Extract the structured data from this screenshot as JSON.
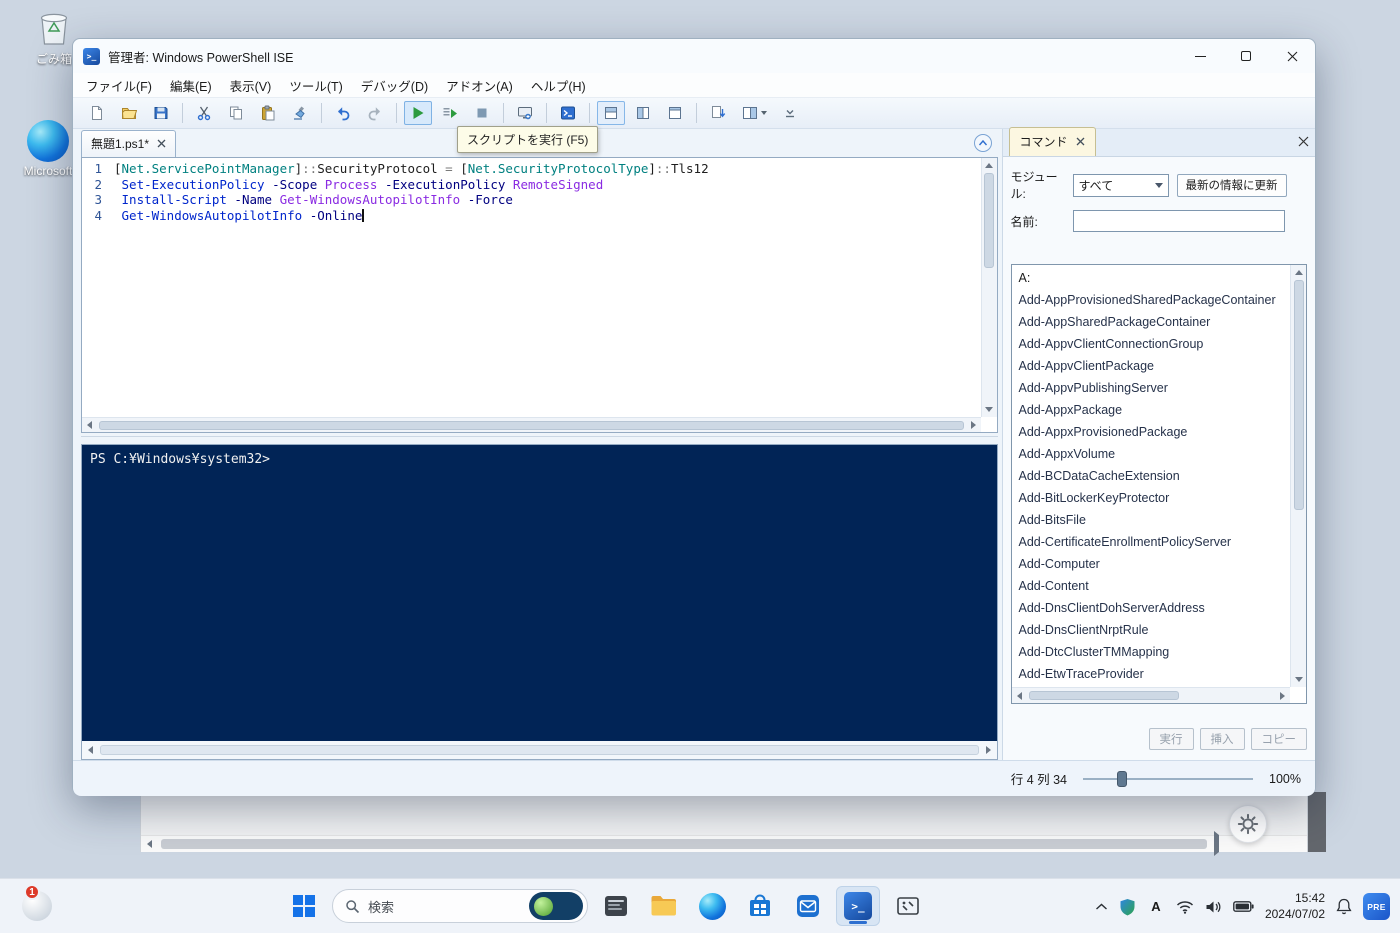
{
  "desktop": {
    "recycle_bin_label": "ごみ箱",
    "edge_label": "Microsoft"
  },
  "ise": {
    "title": "管理者: Windows PowerShell ISE",
    "menus": [
      "ファイル(F)",
      "編集(E)",
      "表示(V)",
      "ツール(T)",
      "デバッグ(D)",
      "アドオン(A)",
      "ヘルプ(H)"
    ],
    "toolbar": [
      "new-script-icon",
      "open-script-icon",
      "save-icon",
      "separator",
      "cut-icon",
      "copy-icon",
      "paste-icon",
      "clear-console-icon",
      "separator",
      "undo-icon",
      "redo-icon",
      "separator",
      "run-script-icon",
      "run-selection-icon",
      "stop-icon",
      "separator",
      "new-remote-tab-icon",
      "separator",
      "console-icon",
      "separator",
      "layout-top-bottom-icon",
      "layout-side-by-side-icon",
      "layout-maximized-icon",
      "separator",
      "script-pane-toggle-icon",
      "script-pane-right-icon",
      "toolbar-overflow-icon"
    ],
    "tooltip": "スクリプトを実行 (F5)",
    "editor": {
      "tab_label": "無題1.ps1*",
      "lines": [
        {
          "n": "1",
          "cursor": false,
          "seg": [
            [
              "[",
              "plain"
            ],
            [
              "Net.ServicePointManager",
              "type"
            ],
            [
              "]",
              "plain"
            ],
            [
              "::",
              "op"
            ],
            [
              "SecurityProtocol",
              "plain"
            ],
            [
              " = ",
              "op"
            ],
            [
              "[",
              "plain"
            ],
            [
              "Net.SecurityProtocolType",
              "type"
            ],
            [
              "]",
              "plain"
            ],
            [
              "::",
              "op"
            ],
            [
              "Tls12",
              "plain"
            ]
          ]
        },
        {
          "n": "2",
          "cursor": false,
          "seg": [
            [
              " ",
              "plain"
            ],
            [
              "Set-ExecutionPolicy",
              "cmd"
            ],
            [
              " ",
              "plain"
            ],
            [
              "-Scope",
              "param"
            ],
            [
              " ",
              "plain"
            ],
            [
              "Process",
              "arg"
            ],
            [
              " ",
              "plain"
            ],
            [
              "-ExecutionPolicy",
              "param"
            ],
            [
              " ",
              "plain"
            ],
            [
              "RemoteSigned",
              "arg"
            ]
          ]
        },
        {
          "n": "3",
          "cursor": false,
          "seg": [
            [
              " ",
              "plain"
            ],
            [
              "Install-Script",
              "cmd"
            ],
            [
              " ",
              "plain"
            ],
            [
              "-Name",
              "param"
            ],
            [
              " ",
              "plain"
            ],
            [
              "Get-WindowsAutopilotInfo",
              "arg"
            ],
            [
              " ",
              "plain"
            ],
            [
              "-Force",
              "param"
            ]
          ]
        },
        {
          "n": "4",
          "cursor": true,
          "seg": [
            [
              " ",
              "plain"
            ],
            [
              "Get-WindowsAutopilotInfo",
              "cmd"
            ],
            [
              " ",
              "plain"
            ],
            [
              "-Online",
              "param"
            ]
          ]
        }
      ]
    },
    "console_prompt": "PS C:¥Windows¥system32>",
    "status": {
      "line_col": "行 4 列 34",
      "zoom": "100%"
    }
  },
  "commands": {
    "tab_label": "コマンド",
    "module_label": "モジュール:",
    "module_value": "すべて",
    "refresh_label": "最新の情報に更新",
    "name_label": "名前:",
    "group": "A:",
    "items": [
      "Add-AppProvisionedSharedPackageContainer",
      "Add-AppSharedPackageContainer",
      "Add-AppvClientConnectionGroup",
      "Add-AppvClientPackage",
      "Add-AppvPublishingServer",
      "Add-AppxPackage",
      "Add-AppxProvisionedPackage",
      "Add-AppxVolume",
      "Add-BCDataCacheExtension",
      "Add-BitLockerKeyProtector",
      "Add-BitsFile",
      "Add-CertificateEnrollmentPolicyServer",
      "Add-Computer",
      "Add-Content",
      "Add-DnsClientDohServerAddress",
      "Add-DnsClientNrptRule",
      "Add-DtcClusterTMMapping",
      "Add-EtwTraceProvider"
    ],
    "buttons": [
      "実行",
      "挿入",
      "コピー"
    ]
  },
  "taskbar": {
    "search_placeholder": "検索",
    "ime": "A",
    "time": "15:42",
    "date": "2024/07/02",
    "badge_count": "1",
    "pre_label": "PRE"
  }
}
